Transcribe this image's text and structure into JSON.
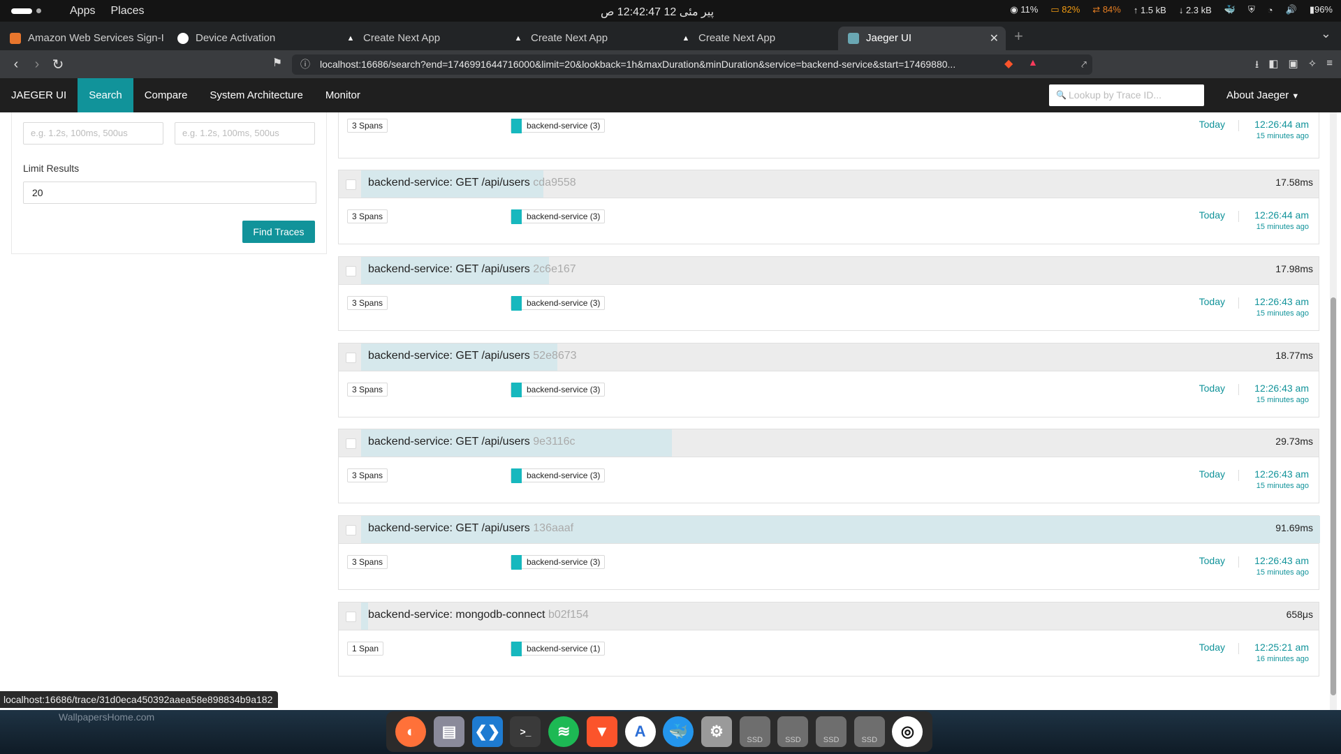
{
  "topbar": {
    "apps": "Apps",
    "places": "Places",
    "clock": "پیر مئی 12 12:42:47 ص",
    "cpu": "11%",
    "mem": "82%",
    "swap": "84%",
    "up": "1.5 kB",
    "down": "2.3 kB",
    "battery": "96%"
  },
  "tabs": [
    {
      "title": "Amazon Web Services Sign-I",
      "color": "#e8762d"
    },
    {
      "title": "Device Activation",
      "color": "#ffffff"
    },
    {
      "title": "Create Next App",
      "color": "#ffffff"
    },
    {
      "title": "Create Next App",
      "color": "#ffffff"
    },
    {
      "title": "Create Next App",
      "color": "#ffffff"
    },
    {
      "title": "Jaeger UI",
      "color": "#6aa7b3"
    }
  ],
  "browser": {
    "url": "localhost:16686/search?end=1746991644716000&limit=20&lookback=1h&maxDuration&minDuration&service=backend-service&start=17469880..."
  },
  "jaeger": {
    "brand": "JAEGER UI",
    "nav": [
      "Search",
      "Compare",
      "System Architecture",
      "Monitor"
    ],
    "lookup_placeholder": "Lookup by Trace ID...",
    "about": "About Jaeger"
  },
  "form": {
    "min_placeholder": "e.g. 1.2s, 100ms, 500us",
    "max_placeholder": "e.g. 1.2s, 100ms, 500us",
    "limit_label": "Limit Results",
    "limit_value": "20",
    "find_button": "Find Traces"
  },
  "first_trace": {
    "spans": "3 Spans",
    "service": "backend-service (3)",
    "day": "Today",
    "time": "12:26:44 am",
    "ago": "15 minutes ago"
  },
  "traces": [
    {
      "title": "backend-service: GET /api/users",
      "id": "cda9558",
      "duration": "17.58ms",
      "fill": 0.19,
      "spans": "3 Spans",
      "service": "backend-service (3)",
      "day": "Today",
      "time": "12:26:44 am",
      "ago": "15 minutes ago"
    },
    {
      "title": "backend-service: GET /api/users",
      "id": "2c6e167",
      "duration": "17.98ms",
      "fill": 0.196,
      "spans": "3 Spans",
      "service": "backend-service (3)",
      "day": "Today",
      "time": "12:26:43 am",
      "ago": "15 minutes ago"
    },
    {
      "title": "backend-service: GET /api/users",
      "id": "52e8673",
      "duration": "18.77ms",
      "fill": 0.205,
      "spans": "3 Spans",
      "service": "backend-service (3)",
      "day": "Today",
      "time": "12:26:43 am",
      "ago": "15 minutes ago"
    },
    {
      "title": "backend-service: GET /api/users",
      "id": "9e3116c",
      "duration": "29.73ms",
      "fill": 0.324,
      "spans": "3 Spans",
      "service": "backend-service (3)",
      "day": "Today",
      "time": "12:26:43 am",
      "ago": "15 minutes ago"
    },
    {
      "title": "backend-service: GET /api/users",
      "id": "136aaaf",
      "duration": "91.69ms",
      "fill": 1.0,
      "spans": "3 Spans",
      "service": "backend-service (3)",
      "day": "Today",
      "time": "12:26:43 am",
      "ago": "15 minutes ago"
    },
    {
      "title": "backend-service: mongodb-connect",
      "id": "b02f154",
      "duration": "658μs",
      "fill": 0.007,
      "spans": "1 Span",
      "service": "backend-service (1)",
      "day": "Today",
      "time": "12:25:21 am",
      "ago": "16 minutes ago"
    }
  ],
  "status_url": "localhost:16686/trace/31d0eca450392aaea58e898834b9a182",
  "desktop": {
    "watermark": "WallpapersHome.com",
    "ssd_label": "SSD"
  },
  "dock": [
    "firefox-icon",
    "files-icon",
    "vscode-icon",
    "terminal-icon",
    "spotify-icon",
    "brave-icon",
    "appstore-icon",
    "docker-icon",
    "settings-icon",
    "ssd-drive-icon",
    "ssd-drive-icon",
    "ssd-drive-icon",
    "ssd-drive-icon",
    "ubuntu-icon"
  ]
}
